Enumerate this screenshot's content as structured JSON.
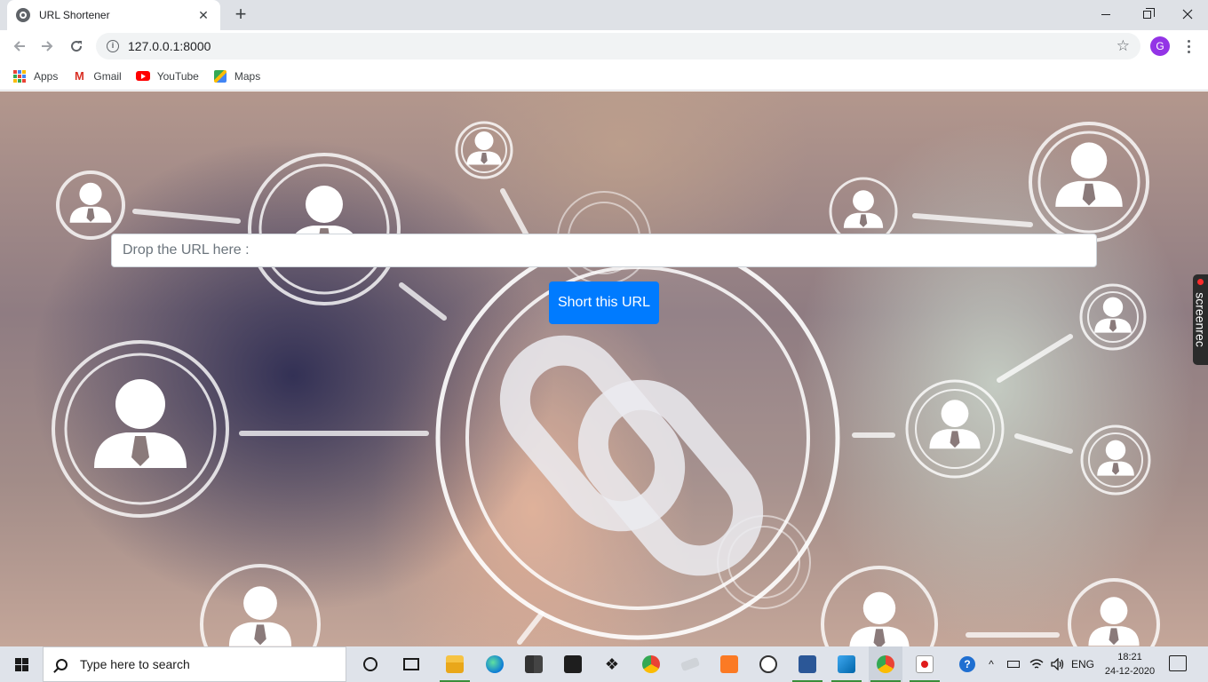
{
  "browser": {
    "tab_title": "URL Shortener",
    "tab_close": "✕",
    "new_tab": "+",
    "address": "127.0.0.1:8000",
    "profile_initial": "G",
    "bookmarks": [
      {
        "label": "Apps",
        "icon": "apps-grid-icon"
      },
      {
        "label": "Gmail",
        "icon": "gmail-icon"
      },
      {
        "label": "YouTube",
        "icon": "youtube-icon"
      },
      {
        "label": "Maps",
        "icon": "maps-icon"
      }
    ]
  },
  "page": {
    "url_placeholder": "Drop the URL here :",
    "button_label": "Short this URL",
    "overlay_badge": "screenrec"
  },
  "taskbar": {
    "search_placeholder": "Type here to search",
    "language": "ENG",
    "time": "18:21",
    "date": "24-12-2020"
  },
  "colors": {
    "primary_button": "#007bff",
    "profile_avatar": "#9334e6"
  }
}
